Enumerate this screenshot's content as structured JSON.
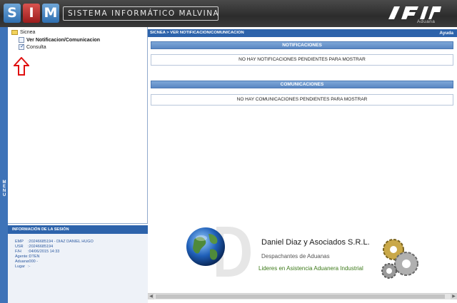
{
  "header": {
    "logo_letters": [
      "S",
      "I",
      "M"
    ],
    "system_title": "SISTEMA INFORMÁTICO MALVINA",
    "brand_logo": "AFIP",
    "brand_subtitle": "Aduana"
  },
  "menu_strip": {
    "label": "MENU"
  },
  "tree": {
    "root": {
      "label": "Sicnea",
      "icon": "folder-icon"
    },
    "items": [
      {
        "label": "Ver Notificacion/Comunicacion",
        "icon": "page-icon",
        "checked": false
      },
      {
        "label": "Consulta",
        "icon": "checkbox-icon",
        "checked": true
      }
    ],
    "annotation": "red-arrow-icon"
  },
  "session": {
    "header": "INFORMACIÓN DE LA SESIÓN",
    "rows": [
      {
        "key": "EMP",
        "value": ":20246685194 - DIAZ DANIEL HUGO"
      },
      {
        "key": "USR",
        "value": ":20246685194"
      },
      {
        "key": "F/H",
        "value": ":04/06/2015 14:33"
      },
      {
        "key": "Agente",
        "value": ":DTEN"
      },
      {
        "key": "Aduana",
        "value": ":000 -"
      },
      {
        "key": "Lugar",
        "value": ":-"
      }
    ]
  },
  "content": {
    "breadcrumb": "SICNEA > VER NOTIFICACION/COMUNICACION",
    "help_label": "Ayuda",
    "notificaciones": {
      "title": "NOTIFICACIONES",
      "message": "NO HAY NOTIFICACIONES PENDIENTES PARA MOSTRAR"
    },
    "comunicaciones": {
      "title": "COMUNICACIONES",
      "message": "NO HAY COMUNICACIONES PENDIENTES PARA MOSTRAR"
    }
  },
  "branding": {
    "company_name": "Daniel Diaz y Asociados S.R.L.",
    "subtitle": "Despachantes de Aduanas",
    "tagline": "Lideres en Asistencia Aduanera Industrial"
  },
  "colors": {
    "header_bg": "#2c2c2c",
    "accent_blue": "#2d63ab",
    "section_blue": "#5a87c2",
    "sim_red": "#9c1c1c",
    "tagline_green": "#3d7a1a"
  }
}
